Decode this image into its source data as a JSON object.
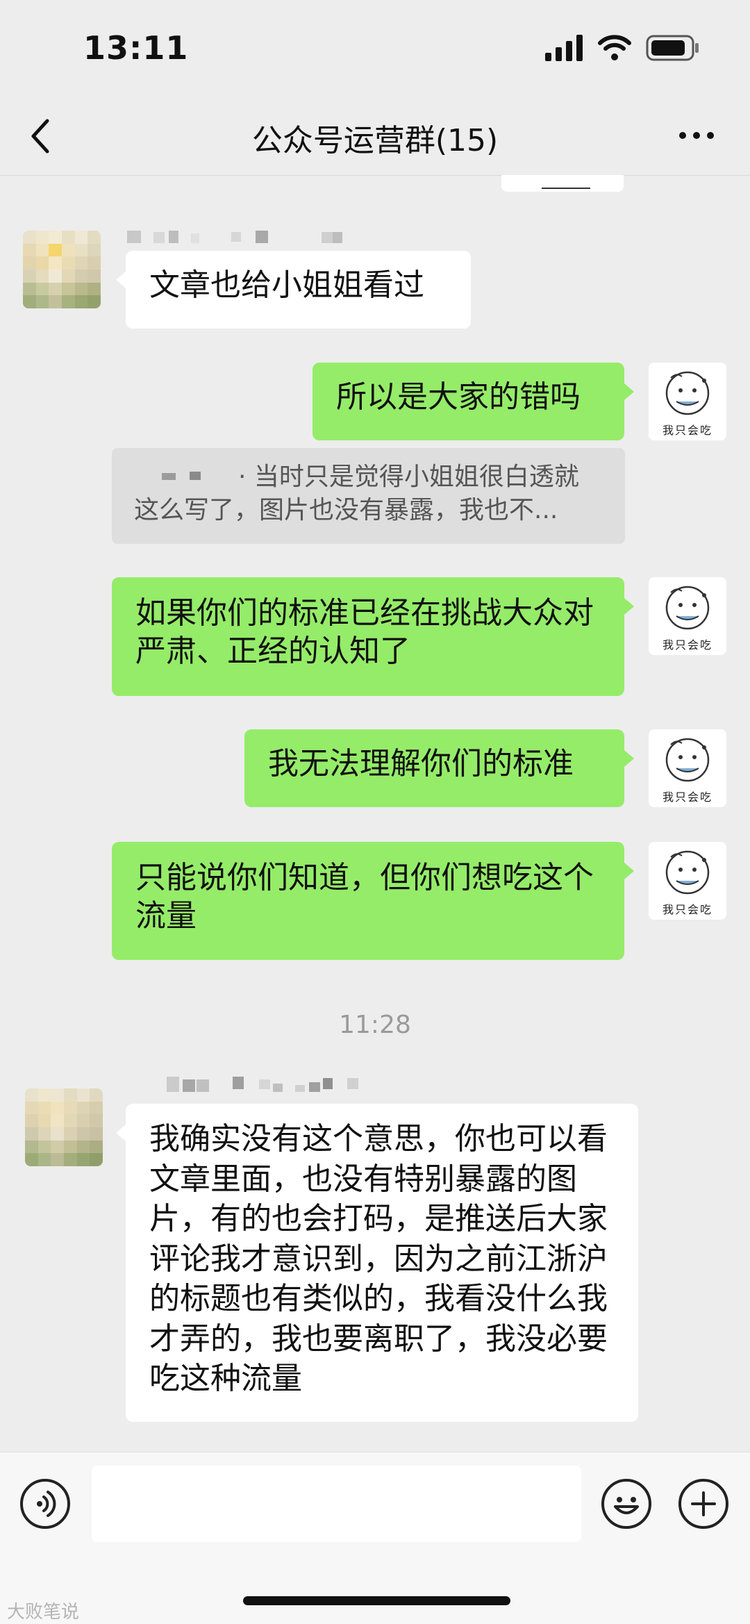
{
  "status": {
    "time": "13:11"
  },
  "header": {
    "title": "公众号运营群(15)"
  },
  "messages": {
    "m1": "文章也给小姐姐看过",
    "m2": "所以是大家的错吗",
    "quote": "· 当时只是觉得小姐姐很白透就这么写了，图片也没有暴露，我也不...",
    "m3": "如果你们的标准已经在挑战大众对严肃、正经的认知了",
    "m4": "我无法理解你们的标准",
    "m5": "只能说你们知道，但你们想吃这个流量",
    "timestamp": "11:28",
    "m6": "我确实没有这个意思，你也可以看文章里面，也没有特别暴露的图片，有的也会打码，是推送后大家评论我才意识到，因为之前江浙沪的标题也有类似的，我看没什么我才弄的，我也要离职了，我没必要吃这种流量"
  },
  "me_avatar_text": "我只会吃",
  "watermark": "大败笔说",
  "icons": {
    "back": "chevron-left-icon",
    "more": "more-dots-icon",
    "voice": "voice-icon",
    "emoji": "emoji-icon",
    "add": "plus-icon"
  }
}
